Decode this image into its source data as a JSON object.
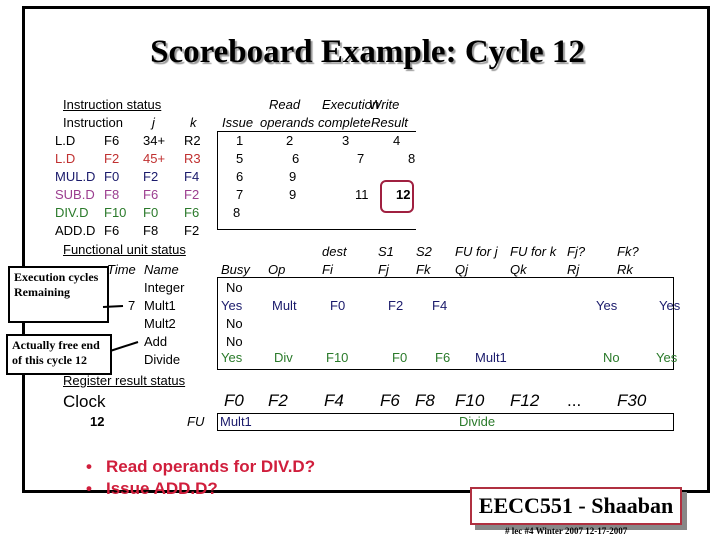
{
  "title": "Scoreboard Example:  Cycle 12",
  "instruction_status": {
    "heading": "Instruction status",
    "headers": {
      "instruction": "Instruction",
      "j": "j",
      "k": "k",
      "issue": "Issue",
      "read_top": "Read",
      "read_bottom": "operands",
      "exec_top": "Execution",
      "exec_bottom": "complete",
      "write_top": "Write",
      "write_bottom": "Result"
    },
    "rows": [
      {
        "op": "L.D",
        "dest": "F6",
        "j": "34+",
        "k": "R2",
        "issue": "1",
        "read": "2",
        "exec": "3",
        "write": "4"
      },
      {
        "op": "L.D",
        "dest": "F2",
        "j": "45+",
        "k": "R3",
        "issue": "5",
        "read": "6",
        "exec": "7",
        "write": "8"
      },
      {
        "op": "MUL.D",
        "dest": "F0",
        "j": "F2",
        "k": "F4",
        "issue": "6",
        "read": "9",
        "exec": "",
        "write": ""
      },
      {
        "op": "SUB.D",
        "dest": "F8",
        "j": "F6",
        "k": "F2",
        "issue": "7",
        "read": "9",
        "exec": "11",
        "write": "12"
      },
      {
        "op": "DIV.D",
        "dest": "F10",
        "j": "F0",
        "k": "F6",
        "issue": "8",
        "read": "",
        "exec": "",
        "write": ""
      },
      {
        "op": "ADD.D",
        "dest": "F6",
        "j": "F8",
        "k": "F2",
        "issue": "",
        "read": "",
        "exec": "",
        "write": ""
      }
    ]
  },
  "functional_unit_status": {
    "heading": "Functional unit status",
    "headers": {
      "time": "Time",
      "name": "Name",
      "busy": "Busy",
      "op": "Op",
      "dest_top": "dest",
      "fi": "Fi",
      "s1_top": "S1",
      "fj": "Fj",
      "s2_top": "S2",
      "fk": "Fk",
      "fuj_top": "FU for j",
      "qj": "Qj",
      "fuk_top": "FU for k",
      "qk": "Qk",
      "fjq_top": "Fj?",
      "rj": "Rj",
      "fkq_top": "Fk?",
      "rk": "Rk"
    },
    "rows": [
      {
        "time": "",
        "name": "Integer",
        "busy": "No",
        "op": "",
        "fi": "",
        "fj": "",
        "fk": "",
        "qj": "",
        "qk": "",
        "rj": "",
        "rk": ""
      },
      {
        "time": "7",
        "name": "Mult1",
        "busy": "Yes",
        "op": "Mult",
        "fi": "F0",
        "fj": "F2",
        "fk": "F4",
        "qj": "",
        "qk": "",
        "rj": "Yes",
        "rk": "Yes"
      },
      {
        "time": "",
        "name": "Mult2",
        "busy": "No",
        "op": "",
        "fi": "",
        "fj": "",
        "fk": "",
        "qj": "",
        "qk": "",
        "rj": "",
        "rk": ""
      },
      {
        "time": "",
        "name": "Add",
        "busy": "No",
        "op": "",
        "fi": "",
        "fj": "",
        "fk": "",
        "qj": "",
        "qk": "",
        "rj": "",
        "rk": ""
      },
      {
        "time": "",
        "name": "Divide",
        "busy": "Yes",
        "op": "Div",
        "fi": "F10",
        "fj": "F0",
        "fk": "F6",
        "qj": "Mult1",
        "qk": "",
        "rj": "No",
        "rk": "Yes"
      }
    ]
  },
  "register_result_status": {
    "heading": "Register result status",
    "clock_label": "Clock",
    "clock_value": "12",
    "fu_label": "FU",
    "registers": [
      "F0",
      "F2",
      "F4",
      "F6",
      "F8",
      "F10",
      "F12",
      "...",
      "F30"
    ],
    "values": [
      "Mult1",
      "",
      "",
      "",
      "",
      "Divide",
      "",
      "",
      ""
    ]
  },
  "callouts": {
    "execution_cycles": "Execution cycles Remaining",
    "actually_free": "Actually free end of this cycle 12"
  },
  "bullets": [
    "Read operands for DIV.D?",
    "Issue ADD.D?"
  ],
  "badge": "EECC551 - Shaaban",
  "footer": "#  lec #4  Winter 2007    12-17-2007"
}
